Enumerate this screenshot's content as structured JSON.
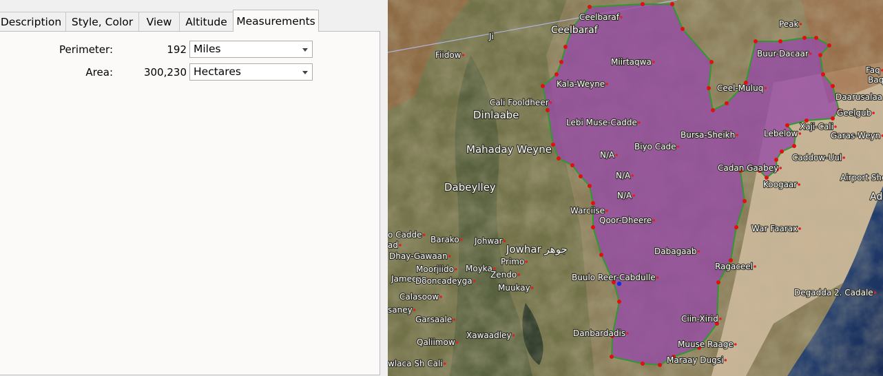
{
  "tabs": [
    {
      "label": "Description"
    },
    {
      "label": "Style, Color"
    },
    {
      "label": "View"
    },
    {
      "label": "Altitude"
    },
    {
      "label": "Measurements"
    }
  ],
  "measurements": {
    "perimeter": {
      "label": "Perimeter:",
      "value": "192",
      "unit": "Miles"
    },
    "area": {
      "label": "Area:",
      "value": "300,230",
      "unit": "Hectares"
    }
  },
  "map": {
    "polygon_fill": "#8e3fa0",
    "polygon_stroke": "#2e9a2e",
    "vertex_color": "#e01010",
    "selected_vertex_color": "#1030e0",
    "place_labels": [
      {
        "text": "Ceelbaraf"
      },
      {
        "text": "Ceelbaraf"
      },
      {
        "text": "Peak"
      },
      {
        "text": "Ji"
      },
      {
        "text": "Fiidow"
      },
      {
        "text": "Buur-Dacaar"
      },
      {
        "text": "Faq"
      },
      {
        "text": "Baqda"
      },
      {
        "text": "Miirtaqwa"
      },
      {
        "text": "Kala-Weyne"
      },
      {
        "text": "Ceel-Muluq"
      },
      {
        "text": "Daarusalaa"
      },
      {
        "text": "Cali Fooldheer"
      },
      {
        "text": "Geelgub"
      },
      {
        "text": "Dinlaabe"
      },
      {
        "text": "Lebi Muse-Cadde"
      },
      {
        "text": "Xaji-Cali"
      },
      {
        "text": "Bursa-Sheikh"
      },
      {
        "text": "Lebelow"
      },
      {
        "text": "Garas-Weyn"
      },
      {
        "text": "Mahaday Weyne"
      },
      {
        "text": "Biyo Cade"
      },
      {
        "text": "N/A"
      },
      {
        "text": "Caddow-Uul"
      },
      {
        "text": "Cadan Gaabey"
      },
      {
        "text": "N/A"
      },
      {
        "text": "Airport Sho"
      },
      {
        "text": "Dabeylley"
      },
      {
        "text": "Koogaar"
      },
      {
        "text": "N/A"
      },
      {
        "text": "Ad"
      },
      {
        "text": "Warciise"
      },
      {
        "text": "Qoor-Dheere"
      },
      {
        "text": "War Faarax"
      },
      {
        "text": "o Cadde"
      },
      {
        "text": "Barako"
      },
      {
        "text": "Johwar"
      },
      {
        "text": "ad"
      },
      {
        "text": "Jowhar جوهر"
      },
      {
        "text": "Dabagaab"
      },
      {
        "text": "Dhay-Gawaan"
      },
      {
        "text": "Primo"
      },
      {
        "text": "Moorjiido"
      },
      {
        "text": "Moyka"
      },
      {
        "text": "Ragaceel"
      },
      {
        "text": "Jameeco"
      },
      {
        "text": "Zendo"
      },
      {
        "text": "Buulo Reer-Cabdulle"
      },
      {
        "text": "Dooncadeyga"
      },
      {
        "text": "Muukay"
      },
      {
        "text": "Degadda 2. Cadale"
      },
      {
        "text": "Calasoow"
      },
      {
        "text": "saney"
      },
      {
        "text": "Ciin-Xirid"
      },
      {
        "text": "Garsaale"
      },
      {
        "text": "Danbardadis"
      },
      {
        "text": "Xawaadley"
      },
      {
        "text": "Qaliimow"
      },
      {
        "text": "Muuse Raage"
      },
      {
        "text": "Maraay Dugsi"
      },
      {
        "text": "wlaca Sh Cali"
      }
    ]
  }
}
